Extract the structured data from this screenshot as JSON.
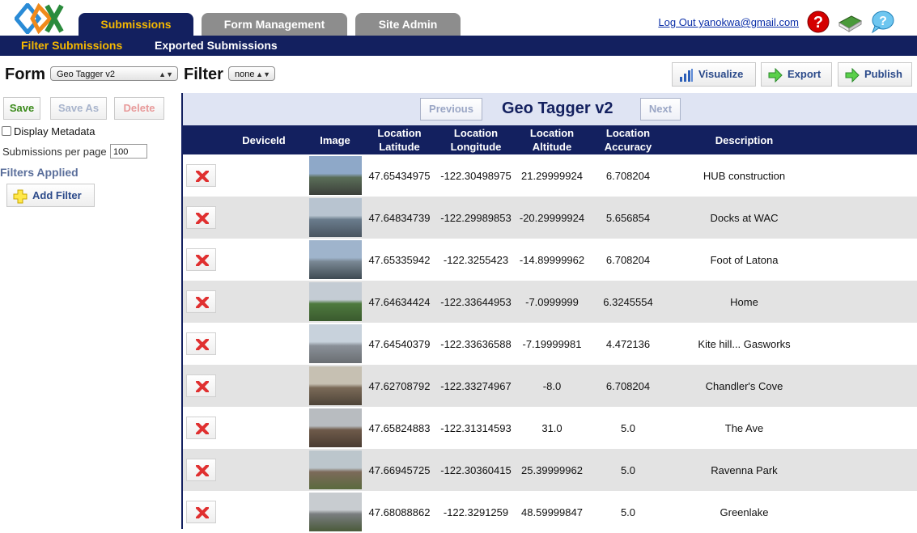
{
  "header": {
    "tabs": [
      {
        "label": "Submissions",
        "active": true
      },
      {
        "label": "Form Management",
        "active": false
      },
      {
        "label": "Site Admin",
        "active": false
      }
    ],
    "user_link": "Log Out yanokwa@gmail.com",
    "icons": [
      "help-icon",
      "book-icon",
      "feedback-icon"
    ]
  },
  "subnav": {
    "items": [
      {
        "label": "Filter Submissions",
        "active": true
      },
      {
        "label": "Exported Submissions",
        "active": false
      }
    ]
  },
  "toolbar": {
    "form_label": "Form",
    "form_value": "Geo Tagger v2",
    "filter_label": "Filter",
    "filter_value": "none",
    "visualize": "Visualize",
    "export": "Export",
    "publish": "Publish"
  },
  "sidebar": {
    "save": "Save",
    "save_as": "Save As",
    "delete": "Delete",
    "display_metadata": "Display Metadata",
    "per_page_label": "Submissions per page",
    "per_page_value": "100",
    "filters_applied": "Filters Applied",
    "add_filter": "Add Filter"
  },
  "main": {
    "title": "Geo Tagger v2",
    "previous": "Previous",
    "next": "Next",
    "columns": [
      "DeviceId",
      "Image",
      "Location Latitude",
      "Location Longitude",
      "Location Altitude",
      "Location Accuracy",
      "Description"
    ],
    "rows": [
      {
        "deviceid": "",
        "latitude": "47.65434975",
        "longitude": "-122.30498975",
        "altitude": "21.29999924",
        "accuracy": "6.708204",
        "description": "HUB construction"
      },
      {
        "deviceid": "",
        "latitude": "47.64834739",
        "longitude": "-122.29989853",
        "altitude": "-20.29999924",
        "accuracy": "5.656854",
        "description": "Docks at WAC"
      },
      {
        "deviceid": "",
        "latitude": "47.65335942",
        "longitude": "-122.3255423",
        "altitude": "-14.89999962",
        "accuracy": "6.708204",
        "description": "Foot of Latona"
      },
      {
        "deviceid": "",
        "latitude": "47.64634424",
        "longitude": "-122.33644953",
        "altitude": "-7.0999999",
        "accuracy": "6.3245554",
        "description": "Home"
      },
      {
        "deviceid": "",
        "latitude": "47.64540379",
        "longitude": "-122.33636588",
        "altitude": "-7.19999981",
        "accuracy": "4.472136",
        "description": "Kite hill... Gasworks"
      },
      {
        "deviceid": "",
        "latitude": "47.62708792",
        "longitude": "-122.33274967",
        "altitude": "-8.0",
        "accuracy": "6.708204",
        "description": "Chandler's Cove"
      },
      {
        "deviceid": "",
        "latitude": "47.65824883",
        "longitude": "-122.31314593",
        "altitude": "31.0",
        "accuracy": "5.0",
        "description": "The Ave"
      },
      {
        "deviceid": "",
        "latitude": "47.66945725",
        "longitude": "-122.30360415",
        "altitude": "25.39999962",
        "accuracy": "5.0",
        "description": "Ravenna Park"
      },
      {
        "deviceid": "",
        "latitude": "47.68088862",
        "longitude": "-122.3291259",
        "altitude": "48.59999847",
        "accuracy": "5.0",
        "description": "Greenlake"
      }
    ]
  }
}
